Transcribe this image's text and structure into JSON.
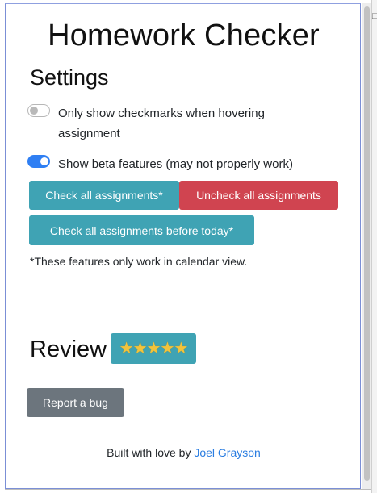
{
  "title": "Homework Checker",
  "settings": {
    "heading": "Settings",
    "options": [
      {
        "label_line1": "Only show checkmarks when hovering",
        "label_line2": "assignment",
        "enabled": false
      },
      {
        "label": "Show beta features (may not properly work)",
        "enabled": true
      }
    ]
  },
  "actions": {
    "check_all": "Check all assignments*",
    "uncheck_all": "Uncheck all assignments",
    "check_before_today": "Check all assignments before today*",
    "note": "*These features only work in calendar view."
  },
  "review": {
    "heading": "Review",
    "stars": "★★★★★",
    "rating": 5
  },
  "report_bug": "Report a bug",
  "footer": {
    "prefix": "Built with love by ",
    "author": "Joel Grayson"
  },
  "colors": {
    "info": "#3fa3b4",
    "danger": "#d04450",
    "secondary": "#6c757d",
    "toggle_on": "#2f7ff3",
    "link": "#2a7de1"
  }
}
